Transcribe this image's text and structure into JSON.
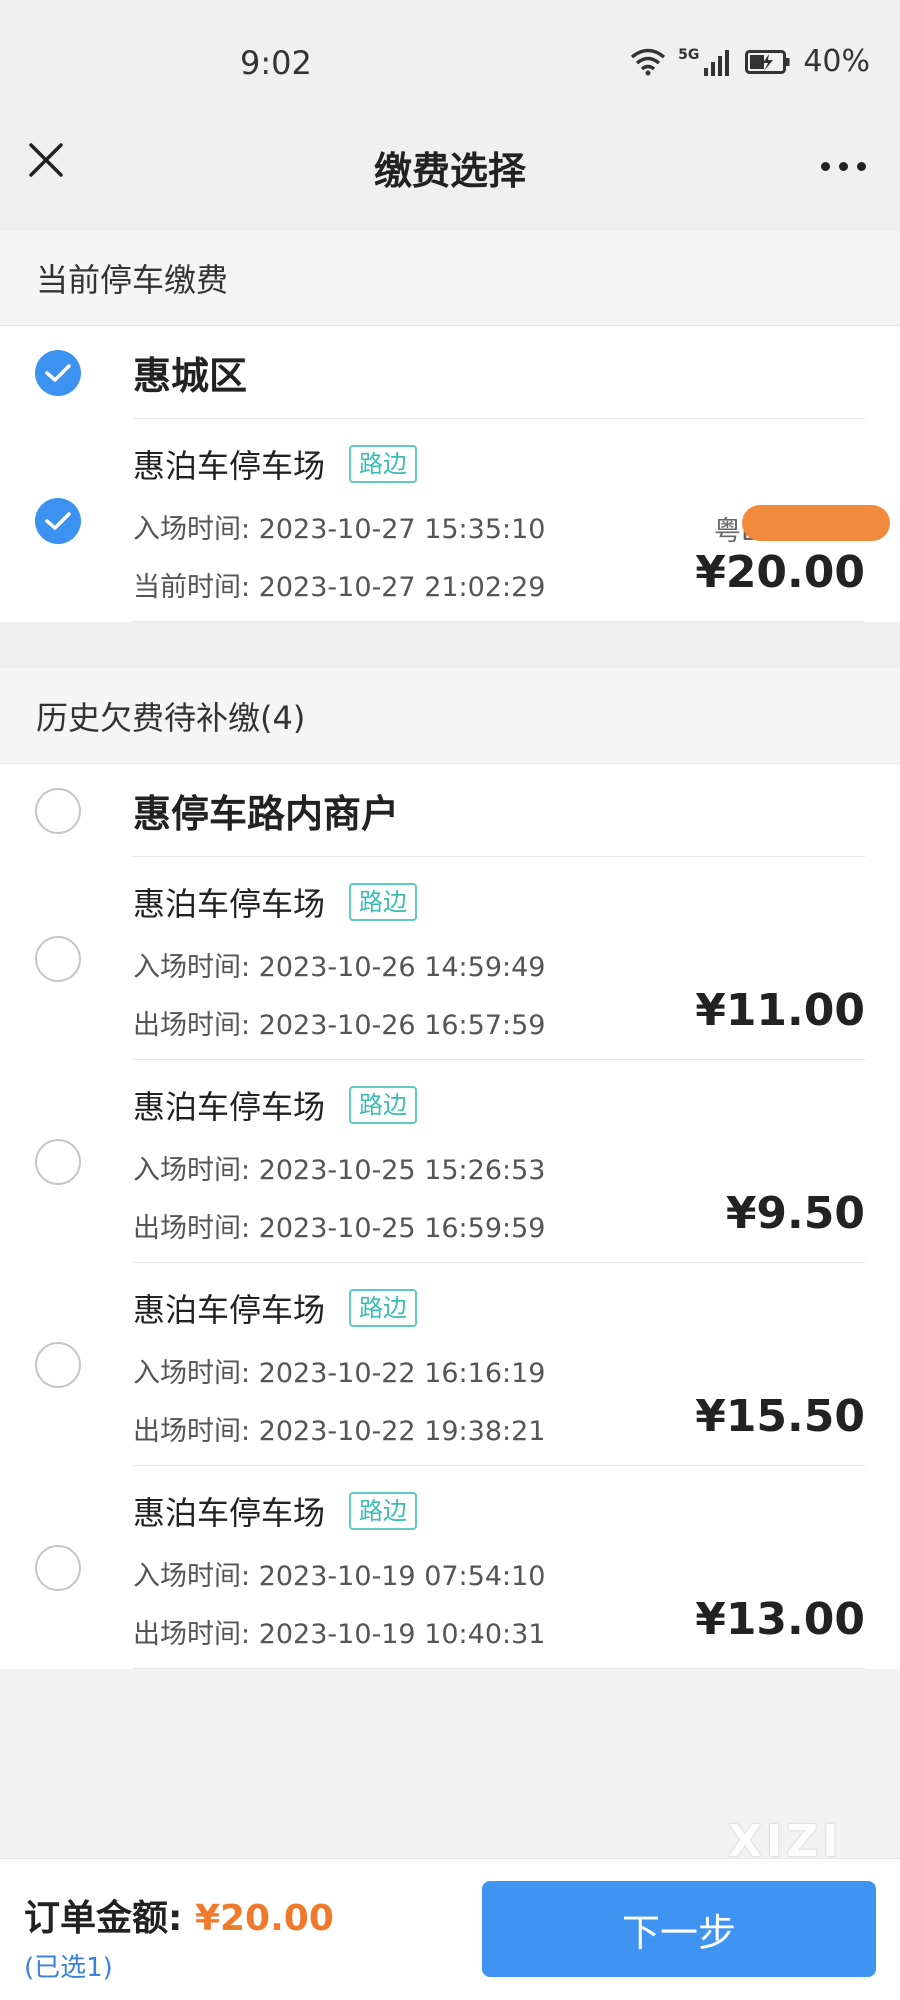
{
  "status_bar": {
    "time": "9:02",
    "network": "5G",
    "battery": "40%"
  },
  "nav": {
    "title": "缴费选择",
    "close_icon": "close-icon",
    "more_icon": "more-icon"
  },
  "current": {
    "header": "当前停车缴费",
    "group": {
      "title": "惠城区",
      "checked": true
    },
    "item": {
      "name": "惠泊车停车场",
      "tag": "路边",
      "entry_label": "入场时间:",
      "entry_time": "2023-10-27 15:35:10",
      "now_label": "当前时间:",
      "now_time": "2023-10-27 21:02:29",
      "plate": "粤L",
      "price": "¥20.00",
      "checked": true
    }
  },
  "history": {
    "header": "历史欠费待补缴(4)",
    "group": {
      "title": "惠停车路内商户",
      "checked": false
    },
    "items": [
      {
        "name": "惠泊车停车场",
        "tag": "路边",
        "entry_label": "入场时间:",
        "entry_time": "2023-10-26 14:59:49",
        "exit_label": "出场时间:",
        "exit_time": "2023-10-26 16:57:59",
        "price": "¥11.00"
      },
      {
        "name": "惠泊车停车场",
        "tag": "路边",
        "entry_label": "入场时间:",
        "entry_time": "2023-10-25 15:26:53",
        "exit_label": "出场时间:",
        "exit_time": "2023-10-25 16:59:59",
        "price": "¥9.50"
      },
      {
        "name": "惠泊车停车场",
        "tag": "路边",
        "entry_label": "入场时间:",
        "entry_time": "2023-10-22 16:16:19",
        "exit_label": "出场时间:",
        "exit_time": "2023-10-22 19:38:21",
        "price": "¥15.50"
      },
      {
        "name": "惠泊车停车场",
        "tag": "路边",
        "entry_label": "入场时间:",
        "entry_time": "2023-10-19 07:54:10",
        "exit_label": "出场时间:",
        "exit_time": "2023-10-19 10:40:31",
        "price": "¥13.00"
      }
    ]
  },
  "watermark": "XIZI",
  "footer": {
    "amount_label": "订单金额:",
    "amount_value": "¥20.00",
    "selected": "(已选1)",
    "next_label": "下一步"
  },
  "colors": {
    "accent": "#3f94f2",
    "price_orange": "#f07a2b",
    "tag_teal": "#3bbdb2"
  }
}
